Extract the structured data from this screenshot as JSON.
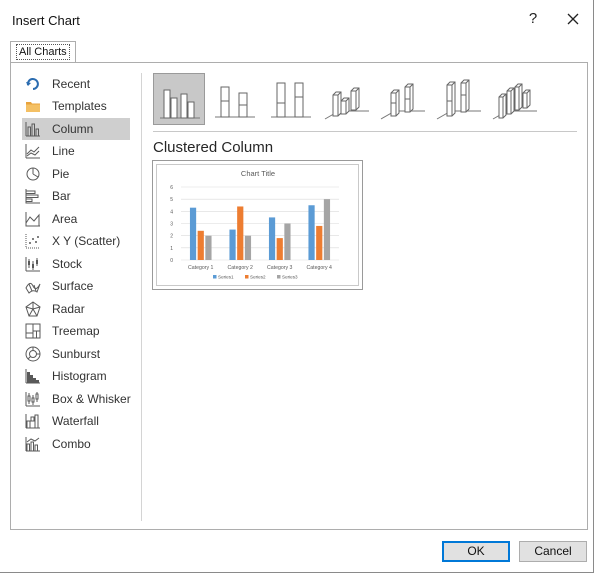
{
  "window": {
    "title": "Insert Chart",
    "help_label": "?"
  },
  "tabs": [
    {
      "label": "All Charts"
    }
  ],
  "sidebar": {
    "items": [
      {
        "label": "Recent",
        "icon": "recent-icon"
      },
      {
        "label": "Templates",
        "icon": "templates-folder-icon"
      },
      {
        "label": "Column",
        "icon": "column-chart-icon",
        "selected": true
      },
      {
        "label": "Line",
        "icon": "line-chart-icon"
      },
      {
        "label": "Pie",
        "icon": "pie-chart-icon"
      },
      {
        "label": "Bar",
        "icon": "bar-chart-icon"
      },
      {
        "label": "Area",
        "icon": "area-chart-icon"
      },
      {
        "label": "X Y (Scatter)",
        "icon": "scatter-chart-icon"
      },
      {
        "label": "Stock",
        "icon": "stock-chart-icon"
      },
      {
        "label": "Surface",
        "icon": "surface-chart-icon"
      },
      {
        "label": "Radar",
        "icon": "radar-chart-icon"
      },
      {
        "label": "Treemap",
        "icon": "treemap-chart-icon"
      },
      {
        "label": "Sunburst",
        "icon": "sunburst-chart-icon"
      },
      {
        "label": "Histogram",
        "icon": "histogram-chart-icon"
      },
      {
        "label": "Box & Whisker",
        "icon": "box-whisker-chart-icon"
      },
      {
        "label": "Waterfall",
        "icon": "waterfall-chart-icon"
      },
      {
        "label": "Combo",
        "icon": "combo-chart-icon"
      }
    ]
  },
  "main": {
    "subtype_title": "Clustered Column",
    "subtypes": [
      {
        "icon": "clustered-column-icon",
        "selected": true
      },
      {
        "icon": "stacked-column-icon"
      },
      {
        "icon": "100-stacked-column-icon"
      },
      {
        "icon": "3d-clustered-column-icon"
      },
      {
        "icon": "3d-stacked-column-icon"
      },
      {
        "icon": "3d-100-stacked-column-icon"
      },
      {
        "icon": "3d-column-icon"
      }
    ]
  },
  "chart_data": {
    "type": "bar",
    "title": "Chart Title",
    "categories": [
      "Category 1",
      "Category 2",
      "Category 3",
      "Category 4"
    ],
    "series": [
      {
        "name": "Series1",
        "values": [
          4.3,
          2.5,
          3.5,
          4.5
        ],
        "color": "#5b9bd5"
      },
      {
        "name": "Series2",
        "values": [
          2.4,
          4.4,
          1.8,
          2.8
        ],
        "color": "#ed7d31"
      },
      {
        "name": "Series3",
        "values": [
          2,
          2,
          3,
          5
        ],
        "color": "#a5a5a5"
      }
    ],
    "yticks": [
      "0",
      "1",
      "2",
      "3",
      "4",
      "5",
      "6"
    ],
    "ylim": [
      0,
      6
    ],
    "grid": true,
    "legend": "bottom"
  },
  "footer": {
    "ok_label": "OK",
    "cancel_label": "Cancel"
  },
  "colors": {
    "accent": "#0078d7",
    "selected_bg": "#cfcfcf",
    "icon_gray": "#595959"
  }
}
